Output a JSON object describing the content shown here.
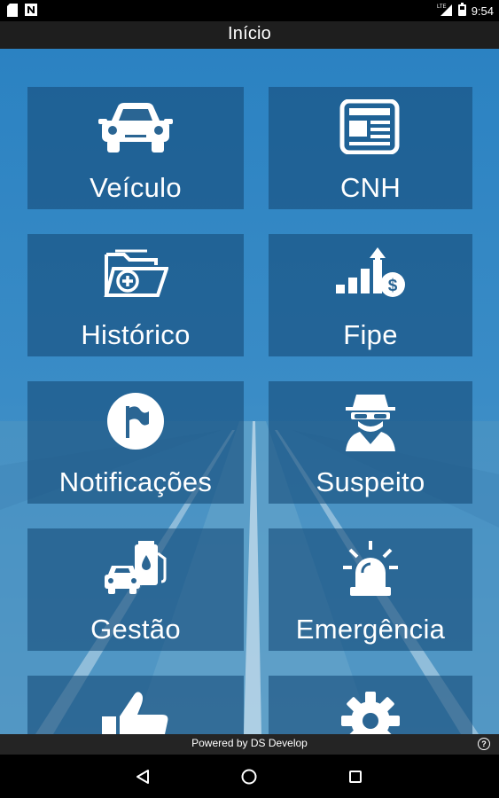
{
  "status_bar": {
    "time": "9:54",
    "network": "LTE"
  },
  "toolbar": {
    "title": "Início"
  },
  "tiles": [
    {
      "label": "Veículo",
      "icon": "car-icon"
    },
    {
      "label": "CNH",
      "icon": "newspaper-icon"
    },
    {
      "label": "Histórico",
      "icon": "folder-add-icon"
    },
    {
      "label": "Fipe",
      "icon": "price-chart-icon"
    },
    {
      "label": "Notificações",
      "icon": "flag-icon"
    },
    {
      "label": "Suspeito",
      "icon": "spy-icon"
    },
    {
      "label": "Gestão",
      "icon": "fuel-car-icon"
    },
    {
      "label": "Emergência",
      "icon": "siren-icon"
    },
    {
      "label": "",
      "icon": "thumbs-up-icon"
    },
    {
      "label": "",
      "icon": "gear-icon"
    }
  ],
  "footer": {
    "text": "Powered by DS Develop",
    "help": "?"
  },
  "colors": {
    "tile_bg": "#164b78",
    "toolbar": "#1e1e1e",
    "footer": "#242424",
    "accent_blue": "#2a80bf"
  }
}
